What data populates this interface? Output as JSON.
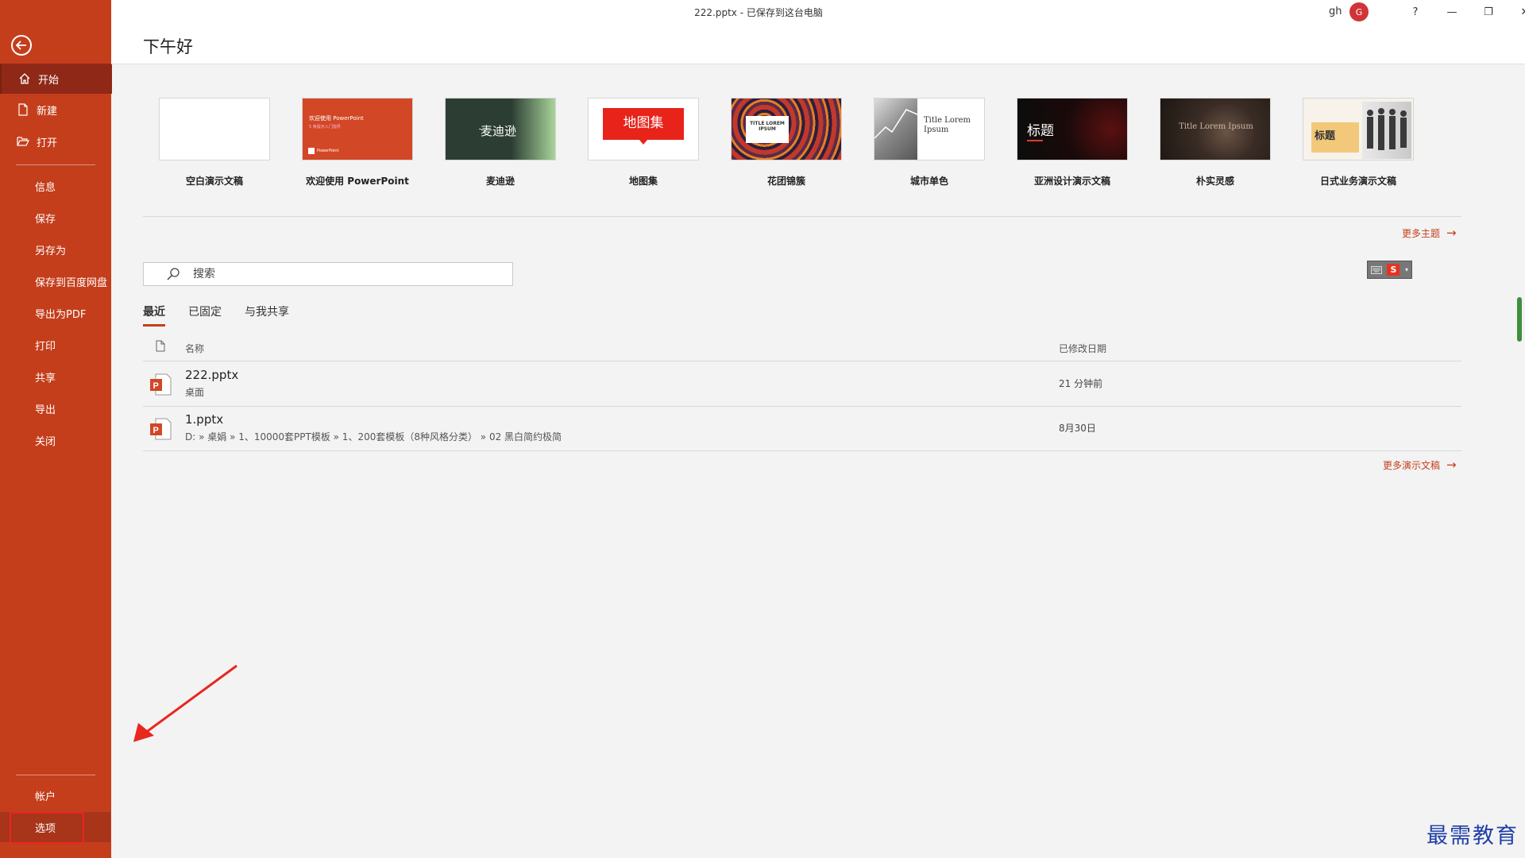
{
  "titlebar": {
    "doc_title": "222.pptx  -  已保存到这台电脑",
    "user_name": "gh",
    "avatar_initial": "G",
    "help": "?",
    "minimize": "—",
    "restore": "❐",
    "close": "✕"
  },
  "header": {
    "greeting": "下午好"
  },
  "sidebar": {
    "items": [
      {
        "label": "开始",
        "icon": "home-icon"
      },
      {
        "label": "新建",
        "icon": "new-doc-icon"
      },
      {
        "label": "打开",
        "icon": "folder-open-icon"
      },
      {
        "label": "信息"
      },
      {
        "label": "保存"
      },
      {
        "label": "另存为"
      },
      {
        "label": "保存到百度网盘"
      },
      {
        "label": "导出为PDF"
      },
      {
        "label": "打印"
      },
      {
        "label": "共享"
      },
      {
        "label": "导出"
      },
      {
        "label": "关闭"
      }
    ],
    "bottom_items": [
      {
        "label": "帐户"
      },
      {
        "label": "选项"
      }
    ]
  },
  "templates": [
    {
      "label": "空白演示文稿"
    },
    {
      "label": "欢迎使用 PowerPoint",
      "thumb_title": "欢迎使用 PowerPoint",
      "thumb_sub": "5 条提示入门指导",
      "thumb_brand": "PowerPoint"
    },
    {
      "label": "麦迪逊",
      "thumb_title": "麦迪逊"
    },
    {
      "label": "地图集",
      "thumb_title": "地图集"
    },
    {
      "label": "花团锦簇",
      "thumb_title": "TITLE LOREM IPSUM"
    },
    {
      "label": "城市单色",
      "thumb_title": "Title Lorem Ipsum"
    },
    {
      "label": "亚洲设计演示文稿",
      "thumb_title": "标题"
    },
    {
      "label": "朴实灵感",
      "thumb_title": "Title Lorem Ipsum"
    },
    {
      "label": "日式业务演示文稿",
      "thumb_title": "标题"
    }
  ],
  "more_themes": "更多主题",
  "search": {
    "placeholder": "搜索"
  },
  "tabs": [
    {
      "label": "最近"
    },
    {
      "label": "已固定"
    },
    {
      "label": "与我共享"
    }
  ],
  "list": {
    "col_name": "名称",
    "col_modified": "已修改日期",
    "files": [
      {
        "name": "222.pptx",
        "path": "桌面",
        "modified": "21 分钟前"
      },
      {
        "name": "1.pptx",
        "path": "D: » 桌娟 » 1、10000套PPT模板 » 1、200套模板（8种风格分类） » 02 黑白简约极简",
        "modified": "8月30日"
      }
    ]
  },
  "more_presentations": "更多演示文稿",
  "watermark": "最需教育",
  "colors": {
    "accent": "#c43e1c",
    "sidebar_active": "#8f2817",
    "highlight_box": "#e8271f",
    "annotation_arrow": "#e8271f"
  }
}
